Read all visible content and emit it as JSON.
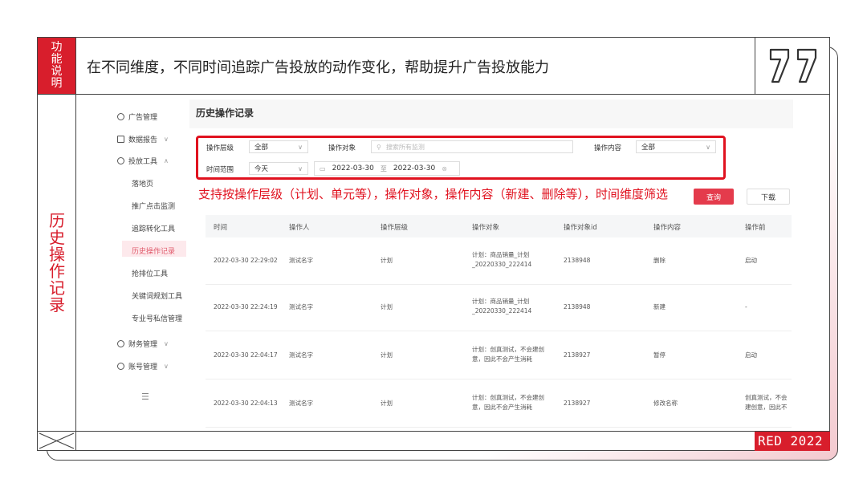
{
  "slide": {
    "tab_label": "功能说明",
    "headline": "在不同维度，不同时间追踪广告投放的动作变化，帮助提升广告投放能力",
    "side_label": "历史操作记录",
    "footer_brand": "RED 2022",
    "accent_color": "#d81e2c"
  },
  "sidebar": {
    "items": [
      {
        "label": "广告管理",
        "icon": "tag-icon"
      },
      {
        "label": "数据报告",
        "icon": "report-icon"
      },
      {
        "label": "投放工具",
        "icon": "tools-icon"
      }
    ],
    "sub_items": [
      "落地页",
      "推广点击监测",
      "追踪转化工具",
      "历史操作记录",
      "抢排位工具",
      "关键词规划工具",
      "专业号私信管理"
    ],
    "bottom_items": [
      {
        "label": "财务管理",
        "icon": "finance-icon"
      },
      {
        "label": "账号管理",
        "icon": "account-icon"
      }
    ],
    "collapse_icon": "collapse-icon"
  },
  "page": {
    "title": "历史操作记录"
  },
  "filters": {
    "level_label": "操作层级",
    "level_value": "全部",
    "object_label": "操作对象",
    "object_placeholder": "搜索所有监测",
    "content_label": "操作内容",
    "content_value": "全部",
    "time_label": "时间范围",
    "time_value": "今天",
    "date_start": "2022-03-30",
    "date_sep": "至",
    "date_end": "2022-03-30"
  },
  "annotation": "支持按操作层级（计划、单元等），操作对象，操作内容（新建、删除等），时间维度筛选",
  "buttons": {
    "query": "查询",
    "download": "下载"
  },
  "table": {
    "headers": [
      "时间",
      "操作人",
      "操作层级",
      "操作对象",
      "操作对象id",
      "操作内容",
      "操作前"
    ],
    "rows": [
      {
        "time": "2022-03-30 22:29:02",
        "user": "测试名字",
        "level": "计划",
        "object": "计划：商品销量_计划_20220330_222414",
        "object_id": "2138948",
        "content": "删除",
        "before": "启动"
      },
      {
        "time": "2022-03-30 22:24:19",
        "user": "测试名字",
        "level": "计划",
        "object": "计划：商品销量_计划_20220330_222414",
        "object_id": "2138948",
        "content": "新建",
        "before": "-"
      },
      {
        "time": "2022-03-30 22:04:17",
        "user": "测试名字",
        "level": "计划",
        "object": "计划：创真测试，不会建创意，因此不会产生消耗",
        "object_id": "2138927",
        "content": "暂停",
        "before": "启动"
      },
      {
        "time": "2022-03-30 22:04:13",
        "user": "测试名字",
        "level": "计划",
        "object": "计划：创真测试，不会建创意，因此不会产生消耗",
        "object_id": "2138927",
        "content": "修改名称",
        "before": "创真测试，不会建创意，因此不会产生消耗"
      }
    ]
  }
}
